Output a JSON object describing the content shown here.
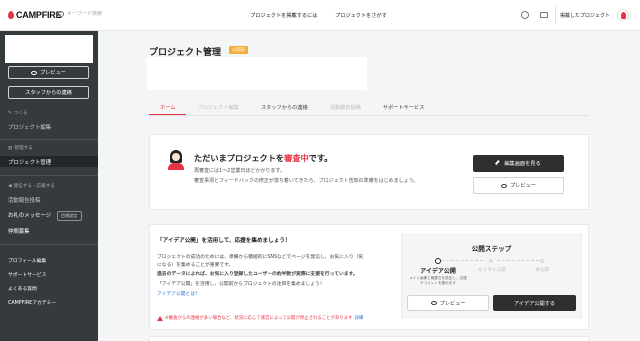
{
  "header": {
    "brand": "CAMPFIRE",
    "search_placeholder": "キーワード検索",
    "nav": [
      "プロジェクトを掲載するには",
      "プロジェクトをさがす"
    ],
    "post_label": "掲載したプロジェクト"
  },
  "sidebar": {
    "preview_label": "プレビュー",
    "contact_label": "スタッフからの連絡",
    "create_section": "つくる",
    "create_items": [
      "プロジェクト編集"
    ],
    "manage_section": "管理する",
    "manage_items": [
      "プロジェクト管理"
    ],
    "deliver_section": "発信する・応援する",
    "deliver_items": [
      "活動報告投稿",
      "お礼のメッセージ",
      "仲間募集"
    ],
    "deliver_badge": "目標設定",
    "bottom_items": [
      "プロフィール編集",
      "サポートサービス",
      "よくある質問",
      "CAMPFIREアカデミー"
    ]
  },
  "page": {
    "title": "プロジェクト管理",
    "status_badge": "公開前",
    "tabs": [
      "ホーム",
      "プロジェクト編集",
      "スタッフからの連絡",
      "活動報告投稿",
      "サポートサービス"
    ],
    "active_tab": "ホーム"
  },
  "review": {
    "heading_prefix": "ただいまプロジェクトを",
    "heading_status": "審査中",
    "heading_suffix": "です。",
    "lines": [
      "再審査には1〜2営業日ほどかかります。",
      "審査事項とフィードバックの修正が落ち着いてきたら、プロジェクト告知の準備をはじめましょう。"
    ],
    "edit_button": "編集画面を見る",
    "preview_button": "プレビュー"
  },
  "idea": {
    "heading": "「アイデア公開」を活用して、応援を集めましょう！",
    "lines": [
      "プロジェクトの成功のためには、準備から積極的にSNSなどでページを発信し、お気に入り（気",
      "になる）を集めることが重要です。",
      "過去のデータによれば、お気に入り登録したユーザーの約半数が実際に支援を行っています。",
      "「アイデア公開」を活用し、公開前からプロジェクトの注目を集めましょう！"
    ],
    "link": "アイデア公開とは？",
    "warning": "※審査からの連絡が多い場合など、状況に応じて運営によって公開が停止されることがあります",
    "warning_link": "詳細"
  },
  "steps": {
    "title": "公開ステップ",
    "labels": [
      "アイデア公開",
      "もうすぐ公開",
      "本公開"
    ],
    "current": 0,
    "description": "メイン画像と概要文を設定し、応援やコメントを集めます",
    "preview_button": "プレビュー",
    "publish_button": "アイデア公開する"
  },
  "colors": {
    "accent": "#e73445",
    "sidebar": "#353a3d",
    "badge": "#f4ae3b",
    "dark_button": "#2e2f31"
  }
}
